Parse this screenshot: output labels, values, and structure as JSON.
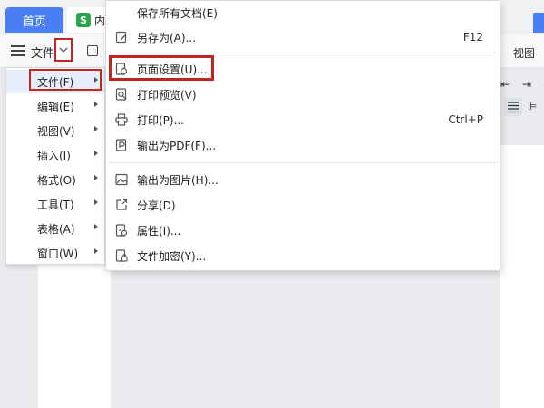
{
  "tabs": {
    "home": "首页",
    "doc_icon": "S",
    "doc": "内"
  },
  "toolbar": {
    "file": "文件",
    "view": "视图"
  },
  "left_menu": [
    {
      "label": "文件(F)"
    },
    {
      "label": "编辑(E)"
    },
    {
      "label": "视图(V)"
    },
    {
      "label": "插入(I)"
    },
    {
      "label": "格式(O)"
    },
    {
      "label": "工具(T)"
    },
    {
      "label": "表格(A)"
    },
    {
      "label": "窗口(W)"
    }
  ],
  "file_menu": {
    "save_all": "保存所有文档(E)",
    "save_as": "另存为(A)...",
    "save_as_shortcut": "F12",
    "page_setup": "页面设置(U)...",
    "print_preview": "打印预览(V)",
    "print": "打印(P)...",
    "print_shortcut": "Ctrl+P",
    "export_pdf": "输出为PDF(F)...",
    "export_image": "输出为图片(H)...",
    "share": "分享(D)",
    "properties": "属性(I)...",
    "encrypt": "文件加密(Y)..."
  },
  "colors": {
    "accent": "#4a7ef5",
    "highlight_box": "#c0261d",
    "active_item": "#e6eefd"
  }
}
